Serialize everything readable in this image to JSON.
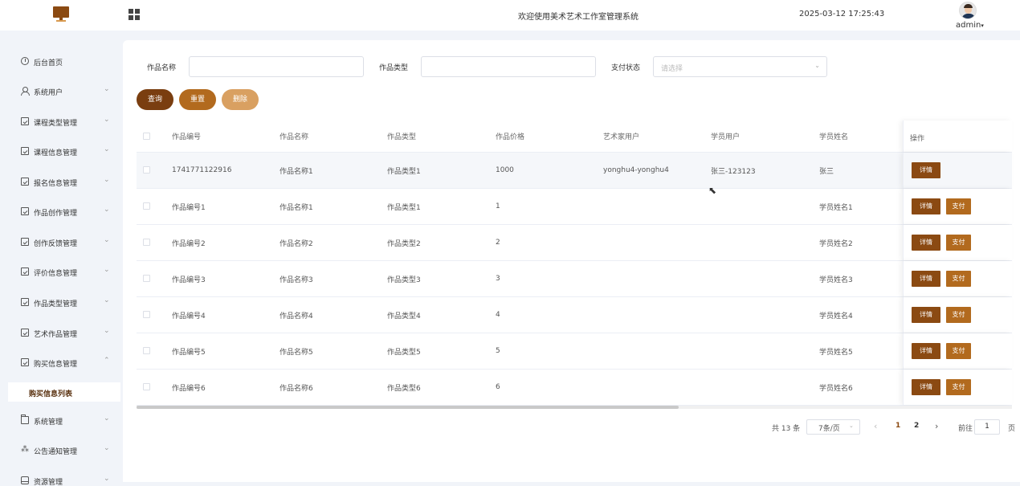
{
  "header": {
    "title": "欢迎使用美术艺术工作室管理系统",
    "datetime": "2025-03-12 17:25:43",
    "user": "admin",
    "user_caret": "▾"
  },
  "sidebar": {
    "items": [
      {
        "label": "后台首页",
        "icon": "clock-icon",
        "arrow": ""
      },
      {
        "label": "系统用户",
        "icon": "user-icon",
        "arrow": "⌄"
      },
      {
        "label": "课程类型管理",
        "icon": "box-icon",
        "arrow": "⌄"
      },
      {
        "label": "课程信息管理",
        "icon": "box-icon",
        "arrow": "⌄"
      },
      {
        "label": "报名信息管理",
        "icon": "box-icon",
        "arrow": "⌄"
      },
      {
        "label": "作品创作管理",
        "icon": "box-icon",
        "arrow": "⌄"
      },
      {
        "label": "创作反馈管理",
        "icon": "box-icon",
        "arrow": "⌄"
      },
      {
        "label": "评价信息管理",
        "icon": "box-icon",
        "arrow": "⌄"
      },
      {
        "label": "作品类型管理",
        "icon": "box-icon",
        "arrow": "⌄"
      },
      {
        "label": "艺术作品管理",
        "icon": "box-icon",
        "arrow": "⌄"
      },
      {
        "label": "购买信息管理",
        "icon": "box-icon",
        "arrow": "⌃"
      },
      {
        "label": "系统管理",
        "icon": "folder-icon",
        "arrow": "⌄"
      },
      {
        "label": "公告通知管理",
        "icon": "spark-icon",
        "arrow": "⌄"
      },
      {
        "label": "资源管理",
        "icon": "drive-icon",
        "arrow": "⌄"
      }
    ],
    "active_sub": "购买信息列表"
  },
  "search": {
    "name_label": "作品名称",
    "type_label": "作品类型",
    "status_label": "支付状态",
    "status_placeholder": "请选择"
  },
  "buttons": {
    "query": "查询",
    "reset": "重置",
    "delete": "删除"
  },
  "table": {
    "headers": [
      "作品编号",
      "作品名称",
      "作品类型",
      "作品价格",
      "艺术家用户",
      "学员用户",
      "学员姓名"
    ],
    "op_header": "操作",
    "detail_label": "详情",
    "pay_label": "支付",
    "rows": [
      {
        "id": "1741771122916",
        "name": "作品名称1",
        "type": "作品类型1",
        "price": "1000",
        "artist": "yonghu4-yonghu4",
        "student_user": "张三-123123",
        "student_name": "张三",
        "can_pay": false
      },
      {
        "id": "作品编号1",
        "name": "作品名称1",
        "type": "作品类型1",
        "price": "1",
        "artist": "",
        "student_user": "",
        "student_name": "学员姓名1",
        "can_pay": true
      },
      {
        "id": "作品编号2",
        "name": "作品名称2",
        "type": "作品类型2",
        "price": "2",
        "artist": "",
        "student_user": "",
        "student_name": "学员姓名2",
        "can_pay": true
      },
      {
        "id": "作品编号3",
        "name": "作品名称3",
        "type": "作品类型3",
        "price": "3",
        "artist": "",
        "student_user": "",
        "student_name": "学员姓名3",
        "can_pay": true
      },
      {
        "id": "作品编号4",
        "name": "作品名称4",
        "type": "作品类型4",
        "price": "4",
        "artist": "",
        "student_user": "",
        "student_name": "学员姓名4",
        "can_pay": true
      },
      {
        "id": "作品编号5",
        "name": "作品名称5",
        "type": "作品类型5",
        "price": "5",
        "artist": "",
        "student_user": "",
        "student_name": "学员姓名5",
        "can_pay": true
      },
      {
        "id": "作品编号6",
        "name": "作品名称6",
        "type": "作品类型6",
        "price": "6",
        "artist": "",
        "student_user": "",
        "student_name": "学员姓名6",
        "can_pay": true
      }
    ]
  },
  "pagination": {
    "total": "共 13 条",
    "page_size": "7条/页",
    "pages": [
      "1",
      "2"
    ],
    "current": "1",
    "goto_prefix": "前往",
    "goto_value": "1",
    "goto_suffix": "页",
    "prev": "‹",
    "next": "›"
  },
  "colors": {
    "primary": "#8b4a12",
    "reset": "#b26a1e",
    "delete": "#d9a061"
  }
}
